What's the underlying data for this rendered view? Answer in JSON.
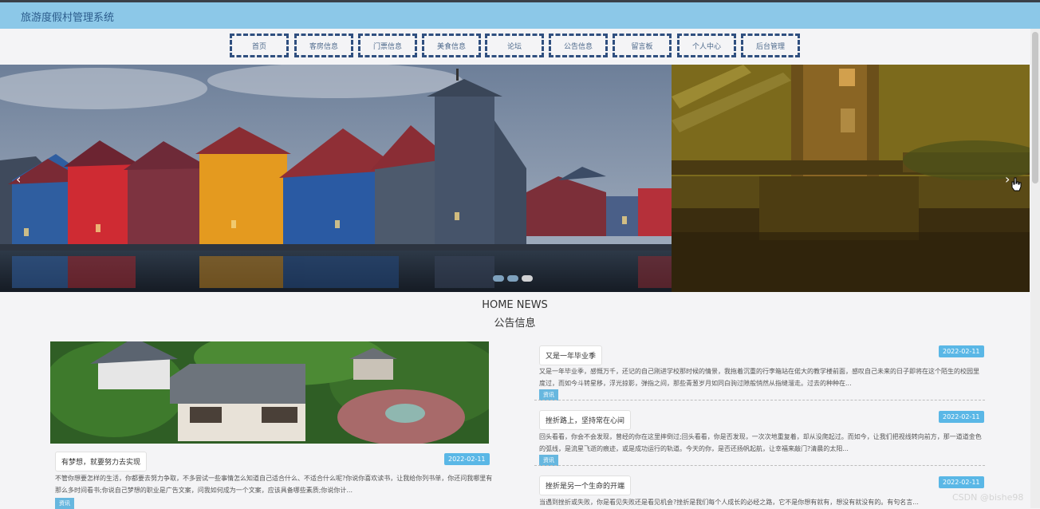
{
  "header": {
    "title": "旅游度假村管理系统"
  },
  "nav": {
    "items": [
      "首页",
      "客房信息",
      "门票信息",
      "美食信息",
      "论坛",
      "公告信息",
      "留言板",
      "个人中心",
      "后台管理"
    ]
  },
  "banner": {
    "prev": "‹",
    "next": "›",
    "slide_count": 3,
    "active_slide": 3
  },
  "news": {
    "heading_en": "HOME NEWS",
    "heading_cn": "公告信息",
    "featured": {
      "title": "有梦想，就要努力去实现",
      "date": "2022-02-11",
      "excerpt": "不管你想要怎样的生活，你都要去努力争取，不多尝试一些事情怎么知道自己适合什么、不适合什么呢?你说你喜欢读书，让我给你列书单，你还问我哪里有那么多时间看书;你说自己梦想的职业是广告文案，问我如何成为一个文案，应该具备哪些素质;你说你计...",
      "tag": "资讯"
    },
    "items": [
      {
        "title": "又是一年毕业季",
        "date": "2022-02-11",
        "excerpt": "又是一年毕业季，感慨万千，还记的自己刚进学校那时候的情景，我拖着沉重的行李箱站在偌大的教学楼前面，感叹自己未来的日子即将在这个陌生的校园里度过，而如今斗转星移，浮光掠影，弹指之间，那些青葱岁月如同白驹过隙般悄然从指缝溜走。过去的种种在...",
        "tag": "资讯"
      },
      {
        "title": "挫折路上，坚持常在心间",
        "date": "2022-02-11",
        "excerpt": "回头看看，你会不会发现，曾经的你在这里摔倒过;回头看看，你是否发现，一次次地重复着，却从没爬起过。而如今，让我们把视线转向前方，那一道道金色的弧线，是流星飞逝的痕迹，或是成功运行的轨道。今天的你，是否还扬帆起航，让幸福来敲门?清晨的太阳...",
        "tag": "资讯"
      },
      {
        "title": "挫折是另一个生命的开端",
        "date": "2022-02-11",
        "excerpt": "当遇到挫折或失败，你是看见失败还是看见机会?挫折是我们每个人成长的必经之路，它不是你想有就有，想没有就没有的。有句名言...",
        "tag": "资讯"
      }
    ]
  },
  "watermark": "CSDN @bishe98",
  "colors": {
    "topbar": "#8cc8e8",
    "nav_border": "#2f4f7f",
    "date_badge": "#5ab7e6",
    "tag": "#67b7df"
  }
}
